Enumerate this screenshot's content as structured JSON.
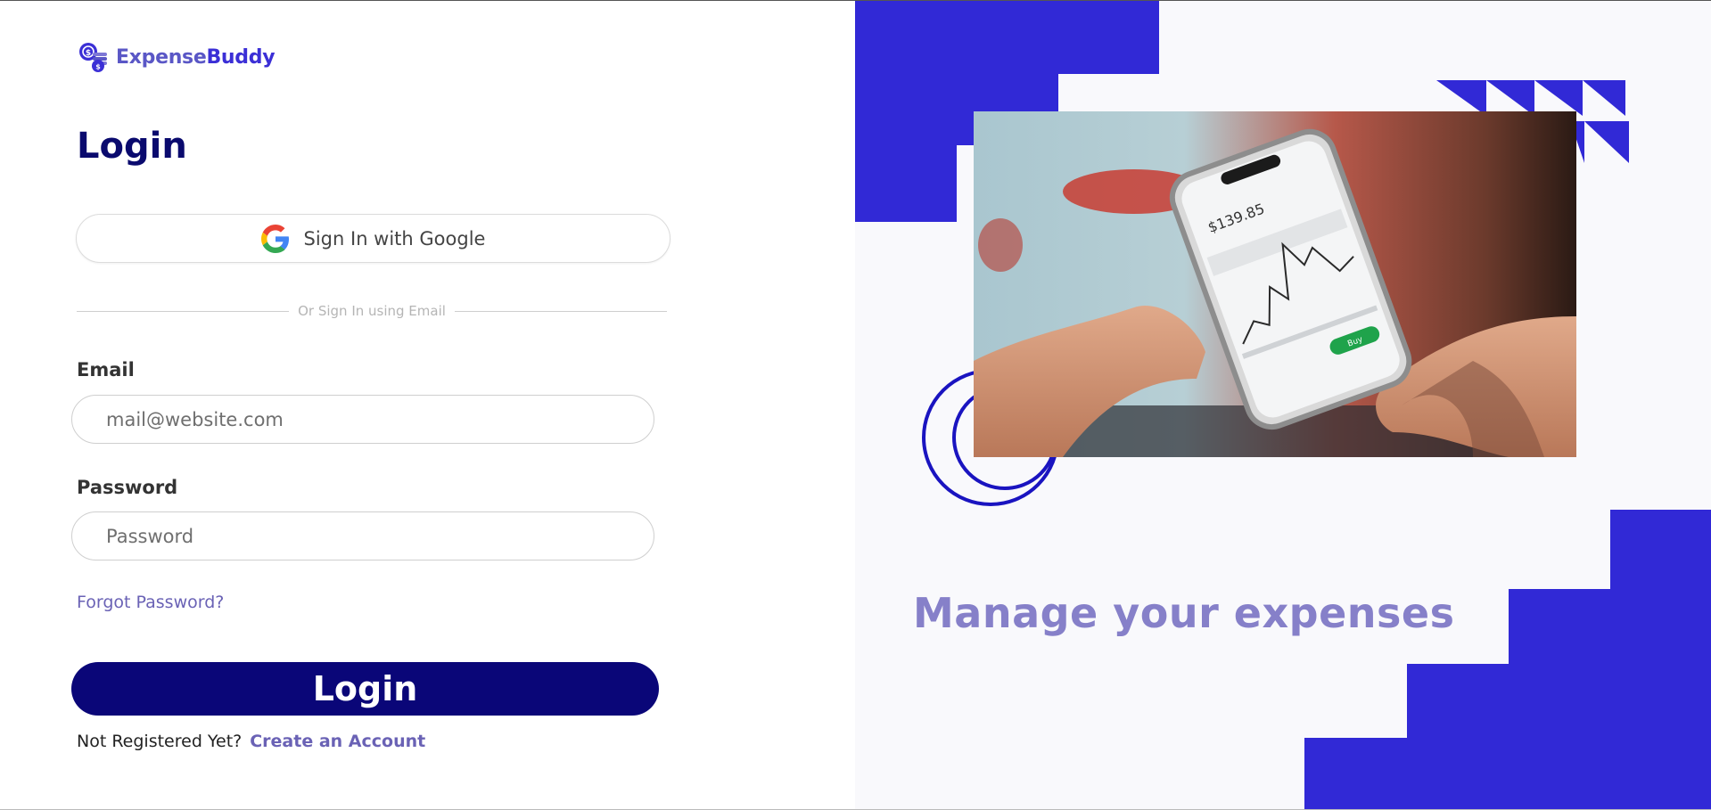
{
  "brand": {
    "name_part1": "Expense",
    "name_part2": "Buddy"
  },
  "login": {
    "title": "Login",
    "google_button_label": "Sign In with Google",
    "divider_text": "Or Sign In using Email",
    "email_label": "Email",
    "email_placeholder": "mail@website.com",
    "email_value": "",
    "password_label": "Password",
    "password_placeholder": "Password",
    "password_value": "",
    "forgot_password": "Forgot Password?",
    "submit_label": "Login",
    "register_prompt": "Not Registered Yet?",
    "register_link": "Create an Account"
  },
  "hero": {
    "tagline": "Manage your expenses",
    "phone_amount": "$139.85",
    "phone_buy_label": "Buy"
  },
  "colors": {
    "primary_dark": "#0a0678",
    "accent": "#3129d6",
    "link": "#6a62b5",
    "tagline": "#8680c9"
  },
  "icons": {
    "logo": "coins-stack-icon",
    "google": "google-g-icon"
  }
}
